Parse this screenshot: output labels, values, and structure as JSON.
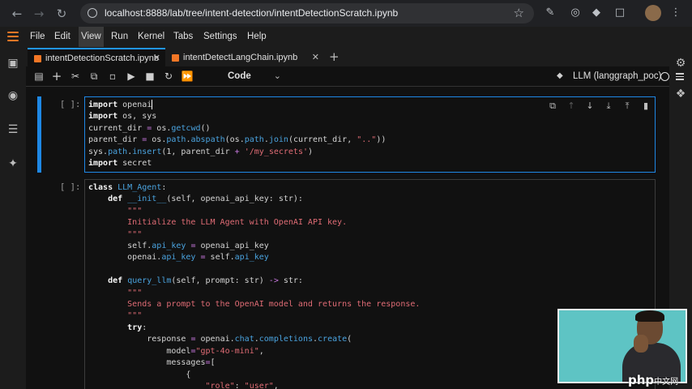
{
  "browser": {
    "url": "localhost:8888/lab/tree/intent-detection/intentDetectionScratch.ipynb"
  },
  "menu": [
    "File",
    "Edit",
    "View",
    "Run",
    "Kernel",
    "Tabs",
    "Settings",
    "Help"
  ],
  "tabs": [
    {
      "label": "intentDetectionScratch.ipynb"
    },
    {
      "label": "intentDetectLangChain.ipynb"
    }
  ],
  "toolbar": {
    "cell_type": "Code",
    "kernel": "LLM (langgraph_poc)"
  },
  "cells": [
    {
      "prompt": "[ ]:",
      "lines": [
        "import openai",
        "import os, sys",
        "current_dir = os.getcwd()",
        "parent_dir = os.path.abspath(os.path.join(current_dir, \"..\"))",
        "sys.path.insert(1, parent_dir + '/my_secrets')",
        "import secret"
      ]
    },
    {
      "prompt": "[ ]:",
      "lines": [
        "class LLM_Agent:",
        "    def __init__(self, openai_api_key: str):",
        "        \"\"\"",
        "        Initialize the LLM Agent with OpenAI API key.",
        "        \"\"\"",
        "        self.api_key = openai_api_key",
        "        openai.api_key = self.api_key",
        "",
        "    def query_llm(self, prompt: str) -> str:",
        "        \"\"\"",
        "        Sends a prompt to the OpenAI model and returns the response.",
        "        \"\"\"",
        "        try:",
        "            response = openai.chat.completions.create(",
        "                model=\"gpt-4o-mini\",",
        "                messages=[",
        "                    {",
        "                        \"role\": \"user\","
      ]
    }
  ],
  "watermark": {
    "main": "php",
    "sub": "中文网"
  }
}
